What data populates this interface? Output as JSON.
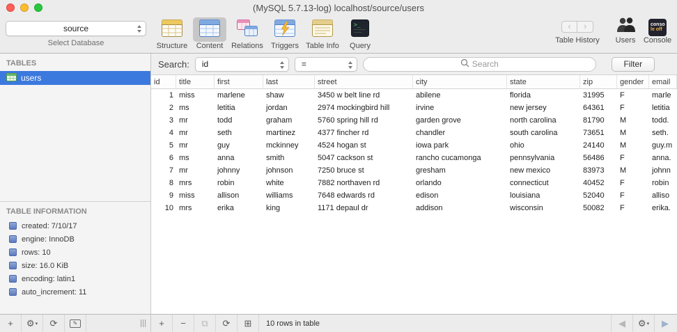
{
  "window": {
    "title": "(MySQL 5.7.13-log) localhost/source/users"
  },
  "toolbar": {
    "database_select": "source",
    "database_label": "Select Database",
    "items": [
      {
        "label": "Structure",
        "selected": false
      },
      {
        "label": "Content",
        "selected": true
      },
      {
        "label": "Relations",
        "selected": false
      },
      {
        "label": "Triggers",
        "selected": false
      },
      {
        "label": "Table Info",
        "selected": false
      },
      {
        "label": "Query",
        "selected": false
      }
    ],
    "history_label": "Table History",
    "users_label": "Users",
    "console_label": "Console",
    "console_icon_text": {
      "line1": "conso",
      "line2": "le off"
    }
  },
  "sidebar": {
    "tables_header": "TABLES",
    "tables": [
      {
        "name": "users",
        "selected": true
      }
    ],
    "info_header": "TABLE INFORMATION",
    "info_items": [
      "created: 7/10/17",
      "engine: InnoDB",
      "rows: 10",
      "size: 16.0 KiB",
      "encoding: latin1",
      "auto_increment: 11"
    ]
  },
  "filterbar": {
    "search_label": "Search:",
    "column_select": "id",
    "operator_select": "=",
    "search_placeholder": "Search",
    "filter_button": "Filter"
  },
  "table": {
    "columns": [
      "id",
      "title",
      "first",
      "last",
      "street",
      "city",
      "state",
      "zip",
      "gender",
      "email"
    ],
    "rows": [
      [
        "1",
        "miss",
        "marlene",
        "shaw",
        "3450 w belt line rd",
        "abilene",
        "florida",
        "31995",
        "F",
        "marle"
      ],
      [
        "2",
        "ms",
        "letitia",
        "jordan",
        "2974 mockingbird hill",
        "irvine",
        "new jersey",
        "64361",
        "F",
        "letitia"
      ],
      [
        "3",
        "mr",
        "todd",
        "graham",
        "5760 spring hill rd",
        "garden grove",
        "north carolina",
        "81790",
        "M",
        "todd."
      ],
      [
        "4",
        "mr",
        "seth",
        "martinez",
        "4377 fincher rd",
        "chandler",
        "south carolina",
        "73651",
        "M",
        "seth."
      ],
      [
        "5",
        "mr",
        "guy",
        "mckinney",
        "4524 hogan st",
        "iowa park",
        "ohio",
        "24140",
        "M",
        "guy.m"
      ],
      [
        "6",
        "ms",
        "anna",
        "smith",
        "5047 cackson st",
        "rancho cucamonga",
        "pennsylvania",
        "56486",
        "F",
        "anna."
      ],
      [
        "7",
        "mr",
        "johnny",
        "johnson",
        "7250 bruce st",
        "gresham",
        "new mexico",
        "83973",
        "M",
        "johnn"
      ],
      [
        "8",
        "mrs",
        "robin",
        "white",
        "7882 northaven rd",
        "orlando",
        "connecticut",
        "40452",
        "F",
        "robin"
      ],
      [
        "9",
        "miss",
        "allison",
        "williams",
        "7648 edwards rd",
        "edison",
        "louisiana",
        "52040",
        "F",
        "alliso"
      ],
      [
        "10",
        "mrs",
        "erika",
        "king",
        "1171 depaul dr",
        "addison",
        "wisconsin",
        "50082",
        "F",
        "erika."
      ]
    ]
  },
  "statusbar": {
    "rows_text": "10 rows in table"
  }
}
